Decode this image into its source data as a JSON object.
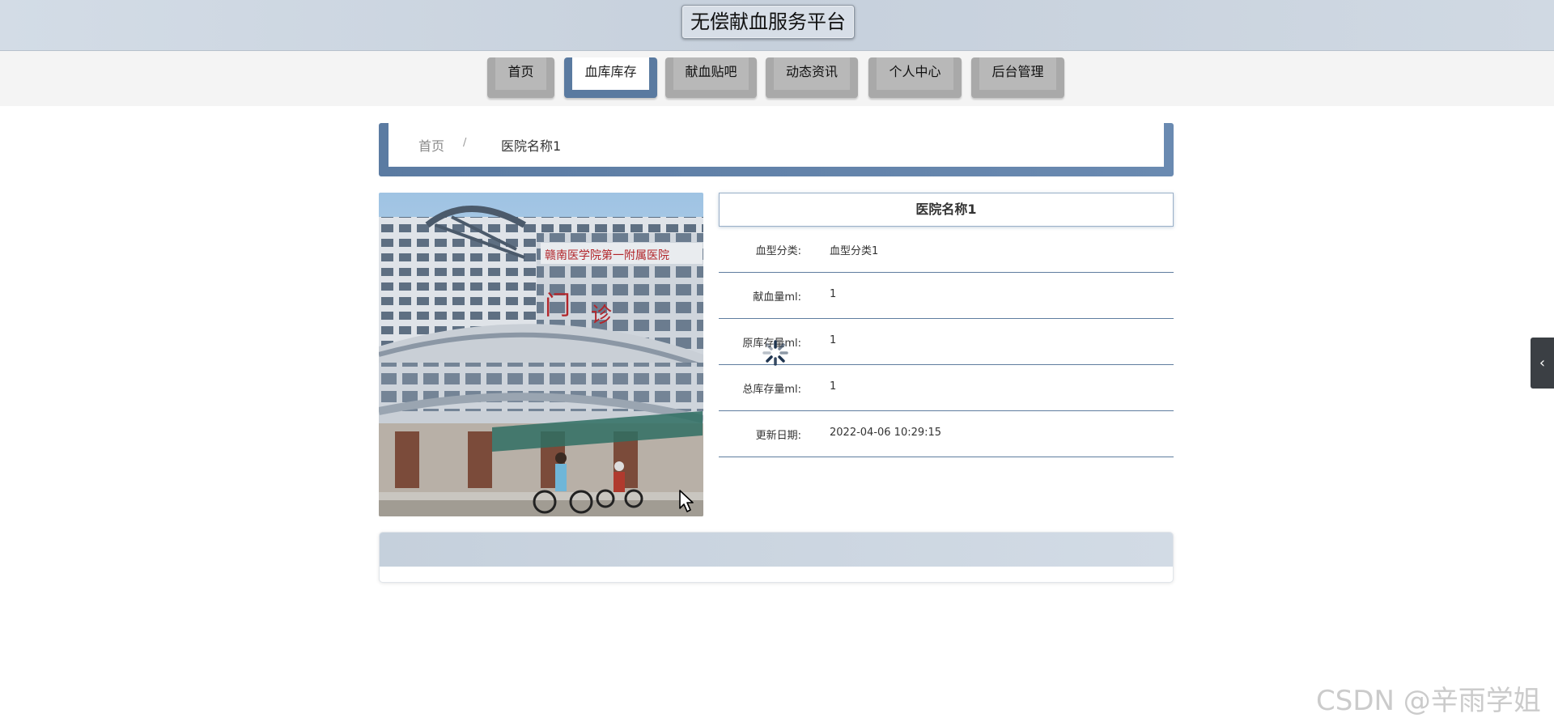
{
  "header": {
    "site_title": "无偿献血服务平台"
  },
  "nav": {
    "items": [
      {
        "label": "首页",
        "active": false
      },
      {
        "label": "血库库存",
        "active": true
      },
      {
        "label": "献血贴吧",
        "active": false
      },
      {
        "label": "动态资讯",
        "active": false
      },
      {
        "label": "个人中心",
        "active": false
      },
      {
        "label": "后台管理",
        "active": false
      }
    ]
  },
  "breadcrumb": {
    "home": "首页",
    "separator": "/",
    "current": "医院名称1"
  },
  "detail": {
    "title": "医院名称1",
    "rows": [
      {
        "label": "血型分类:",
        "value": "血型分类1"
      },
      {
        "label": "献血量ml:",
        "value": "1"
      },
      {
        "label": "原库存量ml:",
        "value": "1"
      },
      {
        "label": "总库存量ml:",
        "value": "1"
      },
      {
        "label": "更新日期:",
        "value": "2022-04-06 10:29:15"
      }
    ]
  },
  "icons": {
    "side_toggle": "chevron-left-icon",
    "spinner": "loading-spinner-icon",
    "cursor": "mouse-pointer-icon"
  },
  "colors": {
    "accent": "#5a7aa0",
    "header_bg": "#c9d3de",
    "nav_button": "#a9a9a9"
  },
  "watermark": "CSDN @辛雨学姐"
}
